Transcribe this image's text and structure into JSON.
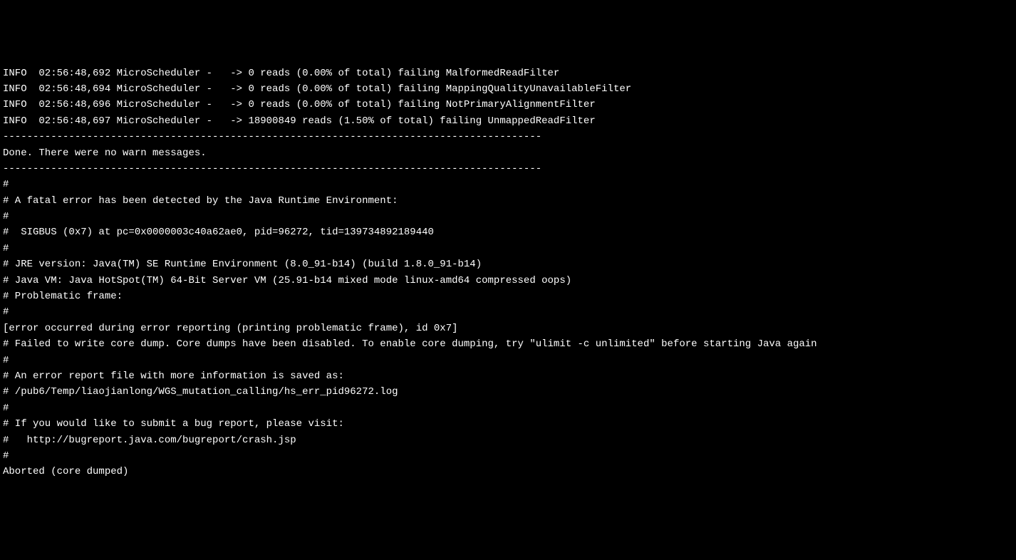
{
  "lines": [
    "INFO  02:56:48,692 MicroScheduler -   -> 0 reads (0.00% of total) failing MalformedReadFilter ",
    "INFO  02:56:48,694 MicroScheduler -   -> 0 reads (0.00% of total) failing MappingQualityUnavailableFilter ",
    "INFO  02:56:48,696 MicroScheduler -   -> 0 reads (0.00% of total) failing NotPrimaryAlignmentFilter ",
    "INFO  02:56:48,697 MicroScheduler -   -> 18900849 reads (1.50% of total) failing UnmappedReadFilter ",
    "------------------------------------------------------------------------------------------",
    "Done. There were no warn messages.",
    "------------------------------------------------------------------------------------------",
    "#",
    "# A fatal error has been detected by the Java Runtime Environment:",
    "#",
    "#  SIGBUS (0x7) at pc=0x0000003c40a62ae0, pid=96272, tid=139734892189440",
    "#",
    "# JRE version: Java(TM) SE Runtime Environment (8.0_91-b14) (build 1.8.0_91-b14)",
    "# Java VM: Java HotSpot(TM) 64-Bit Server VM (25.91-b14 mixed mode linux-amd64 compressed oops)",
    "# Problematic frame:",
    "# ",
    "[error occurred during error reporting (printing problematic frame), id 0x7]",
    "",
    "# Failed to write core dump. Core dumps have been disabled. To enable core dumping, try \"ulimit -c unlimited\" before starting Java again",
    "#",
    "# An error report file with more information is saved as:",
    "# /pub6/Temp/liaojianlong/WGS_mutation_calling/hs_err_pid96272.log",
    "#",
    "# If you would like to submit a bug report, please visit:",
    "#   http://bugreport.java.com/bugreport/crash.jsp",
    "#",
    "Aborted (core dumped)"
  ]
}
